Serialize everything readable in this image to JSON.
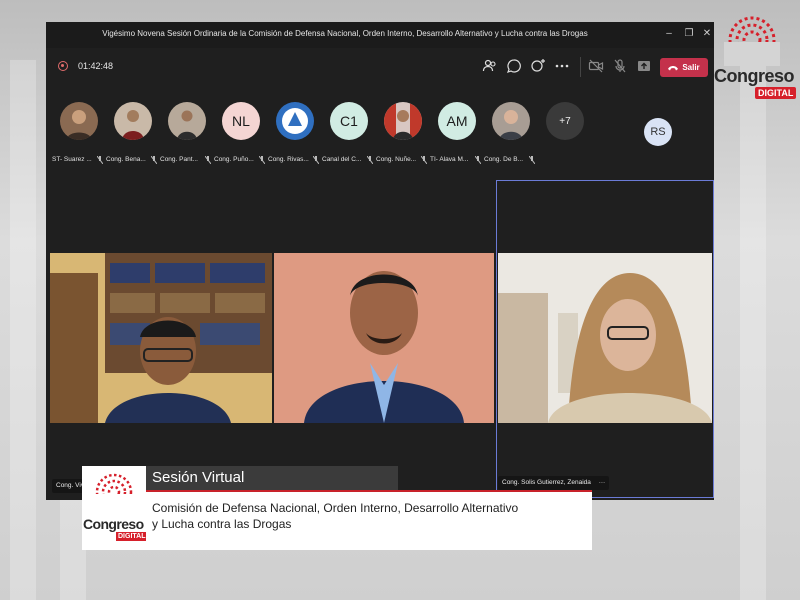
{
  "window": {
    "title": "Vigésimo Novena Sesión Ordinaria de la Comisión de Defensa Nacional, Orden Interno, Desarrollo Alternativo y Lucha contra las Drogas",
    "controls": [
      "minimize-icon",
      "restore-icon",
      "close-icon"
    ]
  },
  "toolbar": {
    "timer": "01:42:48",
    "icons": [
      "people-icon",
      "chat-icon",
      "reactions-icon",
      "more-icon",
      "camera-off-icon",
      "mic-off-icon",
      "share-icon"
    ],
    "leave_label": "Salir",
    "leave_color": "#c4314b"
  },
  "participants": [
    {
      "name": "ST- Suarez ...",
      "initials": "",
      "color": "#8a6a52"
    },
    {
      "name": "Cong. Bena...",
      "initials": "",
      "color": "#c9b9a8"
    },
    {
      "name": "Cong. Pant...",
      "initials": "",
      "color": "#b7a99a"
    },
    {
      "name": "Cong. Puño...",
      "initials": "NL",
      "color": "#f4d5d3"
    },
    {
      "name": "Cong. Rivas...",
      "initials": "",
      "color": "#2f6fc0"
    },
    {
      "name": "Canal del C...",
      "initials": "C1",
      "color": "#d1ece3"
    },
    {
      "name": "Cong. Nuñe...",
      "initials": "",
      "color": "#d8c7c2"
    },
    {
      "name": "TI- Alava M...",
      "initials": "AM",
      "color": "#d1ece3"
    },
    {
      "name": "Cong. De B...",
      "initials": "",
      "color": "#a89d94"
    },
    {
      "name": "",
      "initials": "+7",
      "color": "#3a3a3a"
    }
  ],
  "self_avatar": {
    "initials": "RS"
  },
  "videos": [
    {
      "label": "Cong. Viv..."
    },
    {
      "label": ""
    },
    {
      "label": "Cong. Solis Gutierrez, Zenaida"
    }
  ],
  "lower_third": {
    "brand_word": "Congreso",
    "brand_badge": "DIGITAL",
    "heading": "Sesión Virtual",
    "line1": "Comisión de Defensa Nacional, Orden Interno, Desarrollo Alternativo",
    "line2": "y Lucha contra las Drogas"
  },
  "brand": {
    "word": "Congreso",
    "badge": "DIGITAL",
    "accent": "#d6202b"
  }
}
